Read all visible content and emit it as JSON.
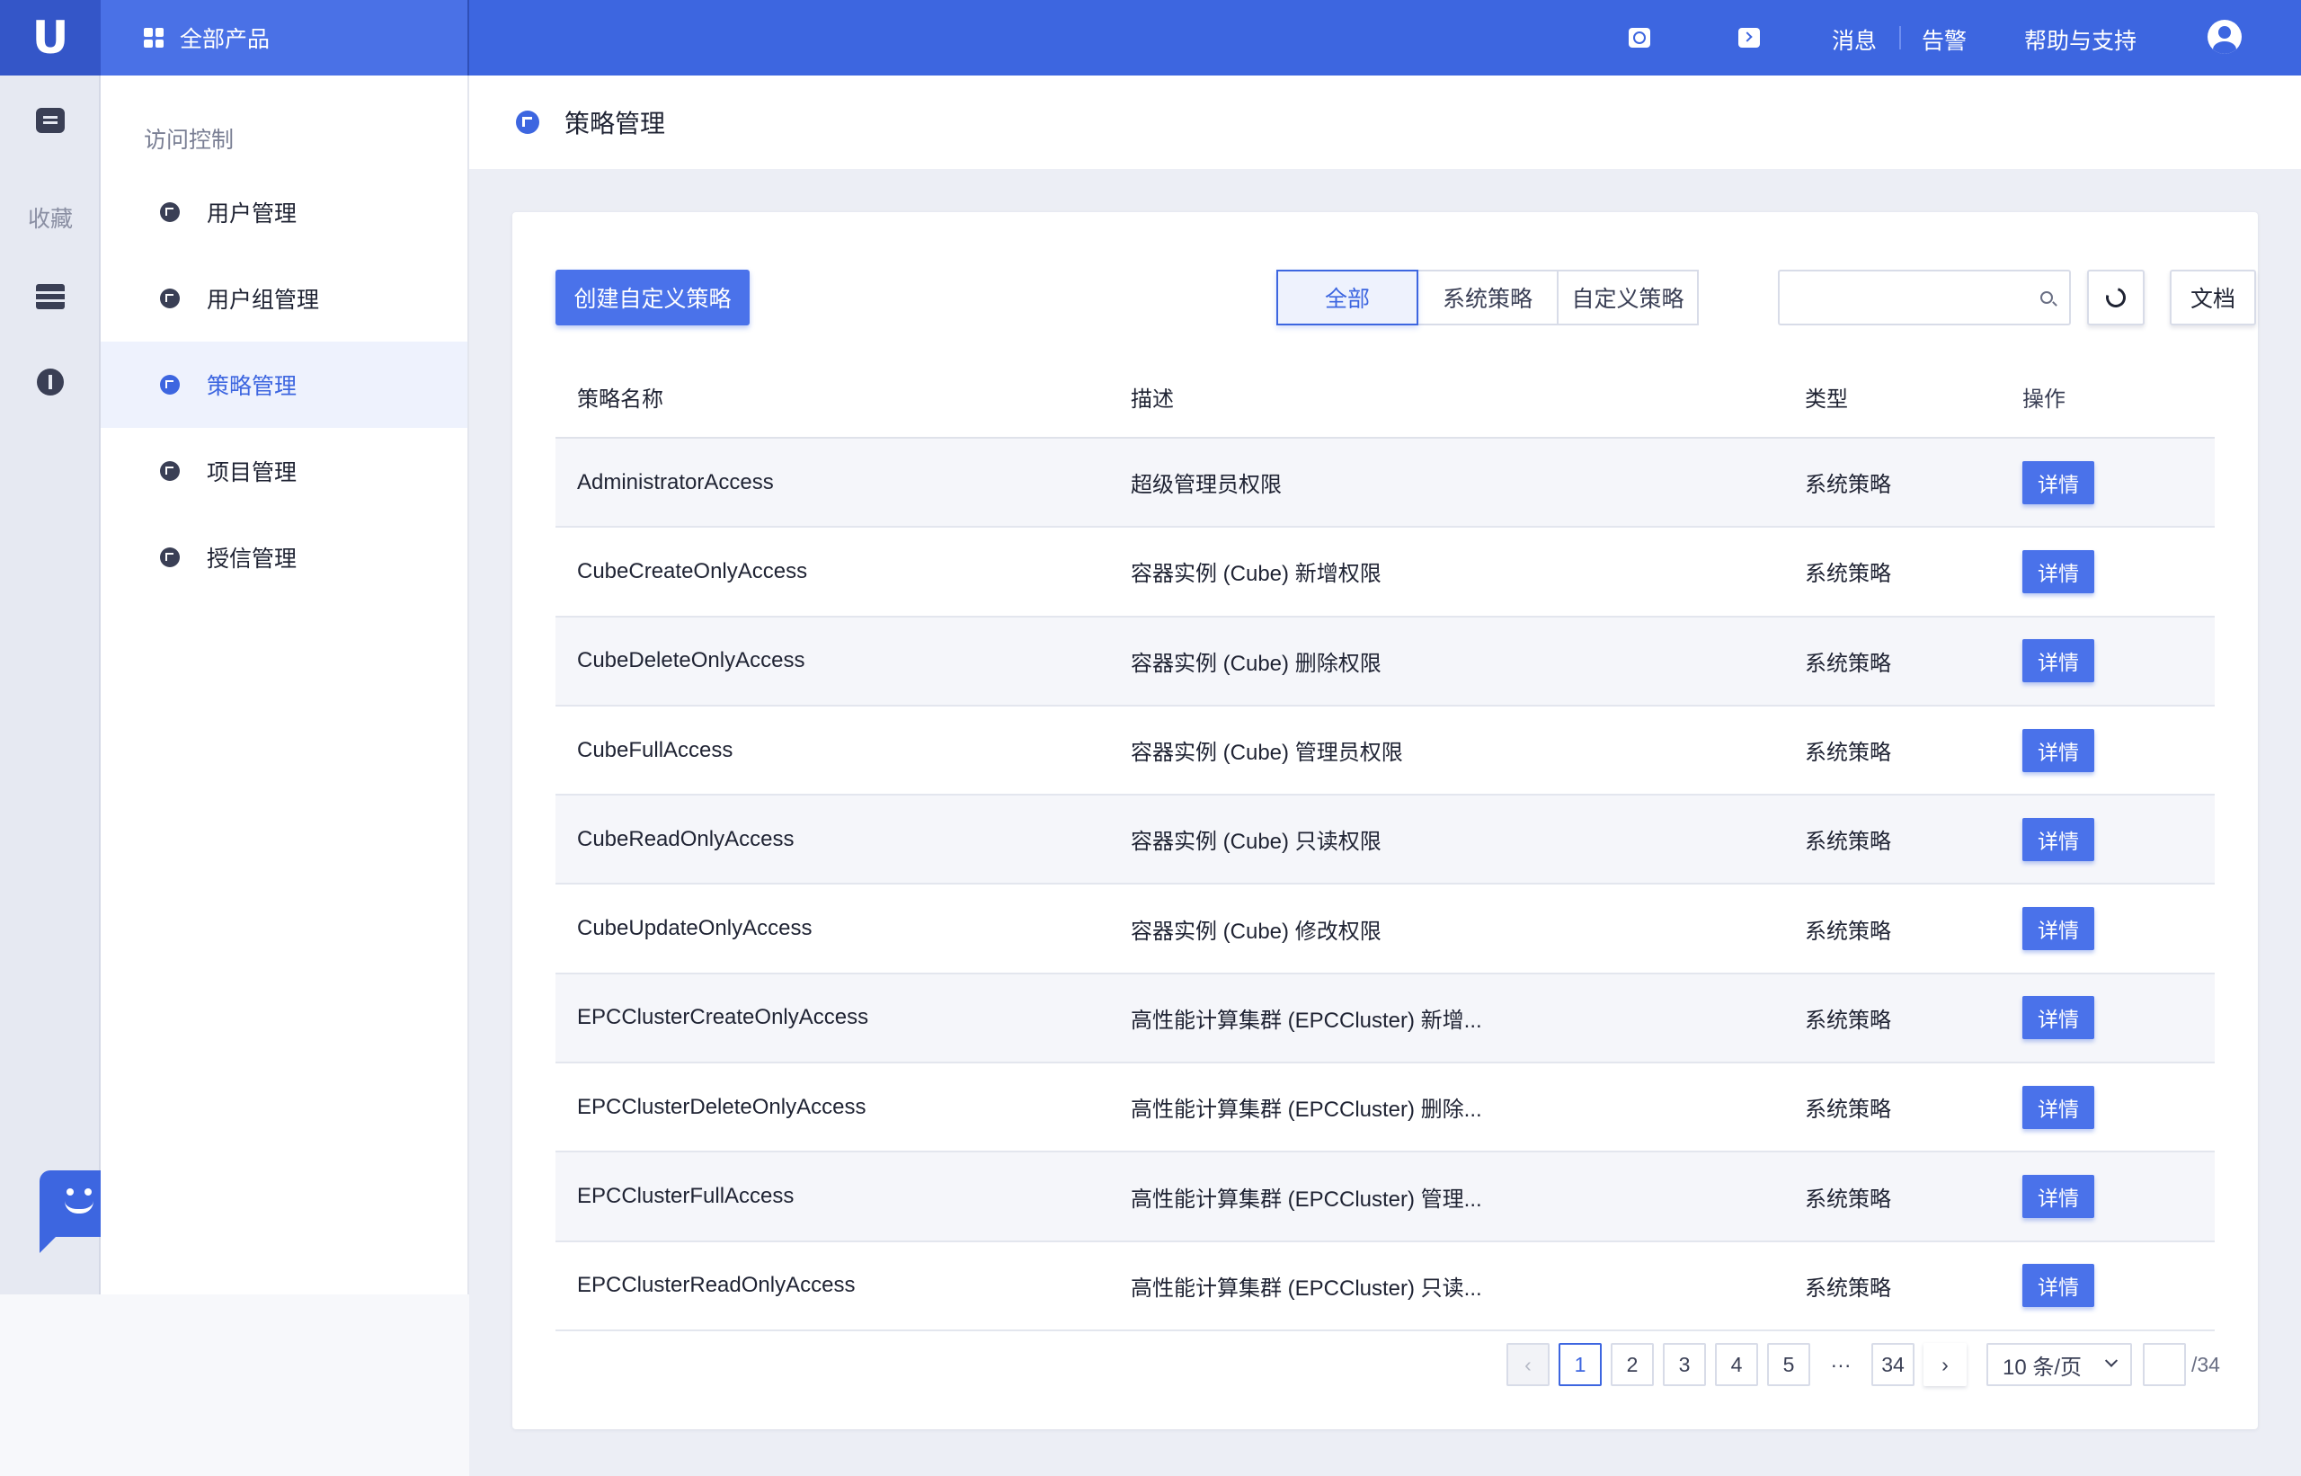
{
  "topbar": {
    "logo": "U",
    "all_products": "全部产品",
    "links": [
      {
        "label": "消息"
      },
      {
        "label": "告警"
      },
      {
        "label": "帮助与支持"
      }
    ]
  },
  "rail": {
    "favorites_label": "收藏"
  },
  "subnav": {
    "title": "访问控制",
    "items": [
      {
        "label": "用户管理",
        "active": false
      },
      {
        "label": "用户组管理",
        "active": false
      },
      {
        "label": "策略管理",
        "active": true
      },
      {
        "label": "项目管理",
        "active": false
      },
      {
        "label": "授信管理",
        "active": false
      }
    ]
  },
  "page": {
    "title": "策略管理"
  },
  "toolbar": {
    "create_label": "创建自定义策略",
    "filters": [
      "全部",
      "系统策略",
      "自定义策略"
    ],
    "active_filter": 0,
    "search_value": "",
    "search_placeholder": "",
    "doc_label": "文档"
  },
  "table": {
    "columns": [
      "策略名称",
      "描述",
      "类型",
      "操作"
    ],
    "action_label": "详情",
    "rows": [
      {
        "name": "AdministratorAccess",
        "desc": "超级管理员权限",
        "type": "系统策略"
      },
      {
        "name": "CubeCreateOnlyAccess",
        "desc": "容器实例 (Cube) 新增权限",
        "type": "系统策略"
      },
      {
        "name": "CubeDeleteOnlyAccess",
        "desc": "容器实例 (Cube) 删除权限",
        "type": "系统策略"
      },
      {
        "name": "CubeFullAccess",
        "desc": "容器实例 (Cube) 管理员权限",
        "type": "系统策略"
      },
      {
        "name": "CubeReadOnlyAccess",
        "desc": "容器实例 (Cube) 只读权限",
        "type": "系统策略"
      },
      {
        "name": "CubeUpdateOnlyAccess",
        "desc": "容器实例 (Cube) 修改权限",
        "type": "系统策略"
      },
      {
        "name": "EPCClusterCreateOnlyAccess",
        "desc": "高性能计算集群 (EPCCluster) 新增...",
        "type": "系统策略"
      },
      {
        "name": "EPCClusterDeleteOnlyAccess",
        "desc": "高性能计算集群 (EPCCluster) 删除...",
        "type": "系统策略"
      },
      {
        "name": "EPCClusterFullAccess",
        "desc": "高性能计算集群 (EPCCluster) 管理...",
        "type": "系统策略"
      },
      {
        "name": "EPCClusterReadOnlyAccess",
        "desc": "高性能计算集群 (EPCCluster) 只读...",
        "type": "系统策略"
      }
    ]
  },
  "pagination": {
    "prev": "‹",
    "pages": [
      "1",
      "2",
      "3",
      "4",
      "5"
    ],
    "current": "1",
    "ellipsis": "···",
    "last": "34",
    "next": "›",
    "page_size": "10 条/页",
    "jump_value": "",
    "total": "/34"
  },
  "colors": {
    "brand": "#3d66e0",
    "button": "#4a72ea"
  }
}
